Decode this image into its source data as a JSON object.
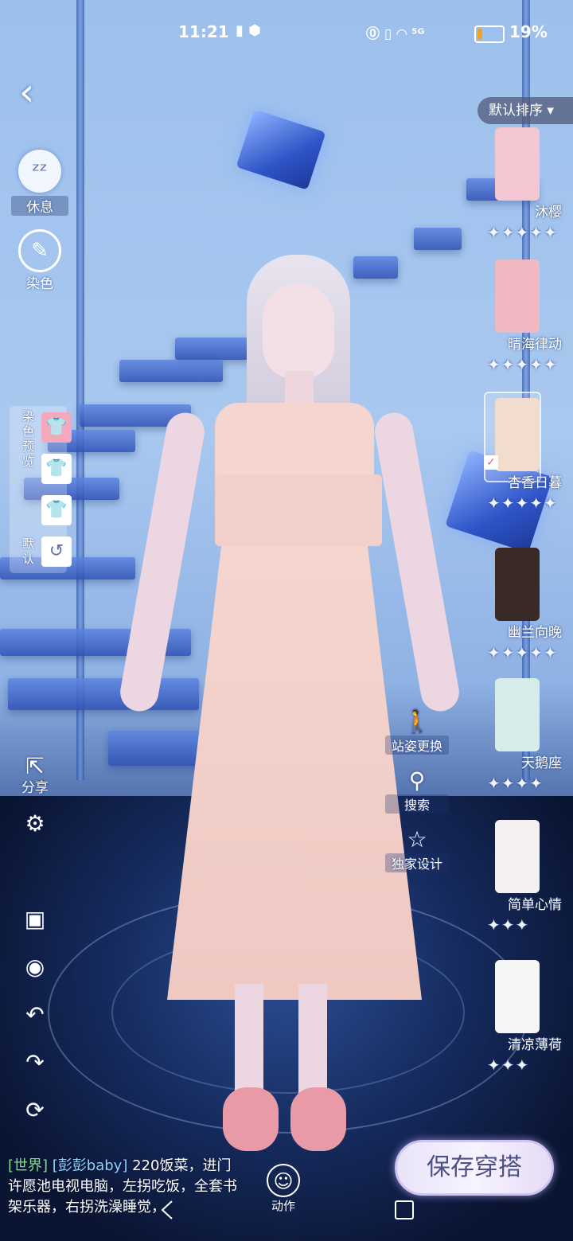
{
  "status_bar": {
    "time": "11:21",
    "left_icons": "▮ ⬢",
    "right_icons": "⓪ ▯ ◠ ⁵ᴳ",
    "battery_percent": "19%",
    "battery_level": 0.19,
    "battery_color": "#f4a020"
  },
  "left_controls": {
    "back_icon": "chevron-left-icon",
    "rest_label": "休息",
    "dye_label": "染色",
    "preview_label": "染色预览",
    "default_label": "默认",
    "share_label": "分享"
  },
  "mid_actions": {
    "pose_label": "站姿更换",
    "search_label": "搜索",
    "exclusive_label": "独家设计"
  },
  "sort": {
    "label": "默认排序",
    "icon": "caret-down-icon"
  },
  "outfits": [
    {
      "name": "沐樱",
      "stars": 5,
      "thumb_color": "#f4c6d2"
    },
    {
      "name": "晴海律动",
      "stars": 5,
      "thumb_color": "#f0b8c0"
    },
    {
      "name": "杏香日暮",
      "stars": 5,
      "thumb_color": "#f2dccd",
      "selected": true
    },
    {
      "name": "幽兰向晚",
      "stars": 5,
      "thumb_color": "#3a2a26"
    },
    {
      "name": "天鹅座",
      "stars": 4,
      "thumb_color": "#d6ecea"
    },
    {
      "name": "简单心情",
      "stars": 3,
      "thumb_color": "#f5f0f0"
    },
    {
      "name": "清凉薄荷",
      "stars": 3,
      "thumb_color": "#f4f6f4"
    }
  ],
  "chat": {
    "channel": "[世界]",
    "user": "[彭彭baby]",
    "message": "220饭菜，进门许愿池电视电脑，左拐吃饭，全套书架乐器，右拐洗澡睡觉，"
  },
  "action_label": "动作",
  "save_label": "保存穿搭",
  "colors": {
    "accent": "#4b4f86",
    "star": "#f3f6ff",
    "chat_channel": "#7fe08c",
    "chat_user": "#8fd0ff"
  }
}
